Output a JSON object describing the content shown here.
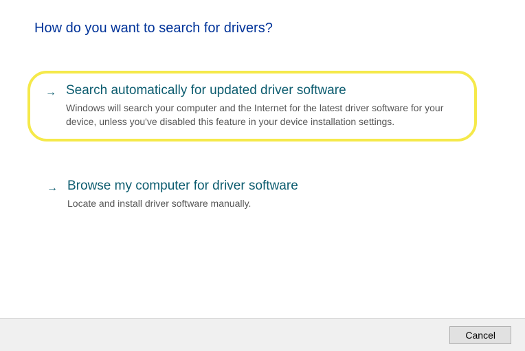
{
  "title": "How do you want to search for drivers?",
  "options": [
    {
      "title": "Search automatically for updated driver software",
      "description": "Windows will search your computer and the Internet for the latest driver software for your device, unless you've disabled this feature in your device installation settings.",
      "highlighted": true
    },
    {
      "title": "Browse my computer for driver software",
      "description": "Locate and install driver software manually.",
      "highlighted": false
    }
  ],
  "buttons": {
    "cancel": "Cancel"
  }
}
